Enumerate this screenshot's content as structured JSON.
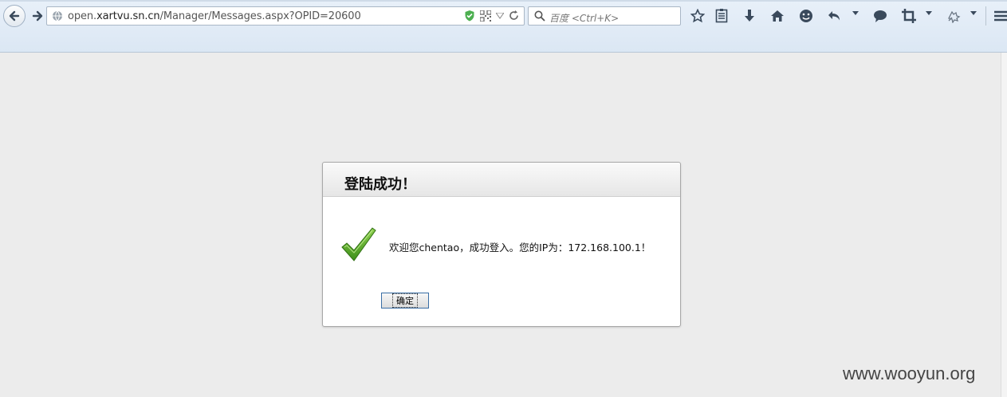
{
  "browser": {
    "url_host_prefix": "open.",
    "url_host": "xartvu.sn.cn",
    "url_path": "/Manager/Messages.aspx?OPID=20600",
    "search_placeholder": "百度 <Ctrl+K>",
    "toolbar_icons": [
      "bookmark-star-icon",
      "reader-icon",
      "download-icon",
      "home-icon",
      "smiley-icon",
      "undo-icon",
      "chat-icon",
      "crop-icon",
      "extension-icon",
      "menu-icon"
    ]
  },
  "dialog": {
    "title": "登陆成功！",
    "message": "欢迎您chentao，成功登入。您的IP为：172.168.100.1！",
    "ok_label": "确定",
    "icon": "checkmark-icon"
  },
  "watermark": "www.wooyun.org",
  "colors": {
    "check_green": "#5fb52b",
    "page_bg": "#ececec",
    "button_border": "#3a6ea5"
  }
}
